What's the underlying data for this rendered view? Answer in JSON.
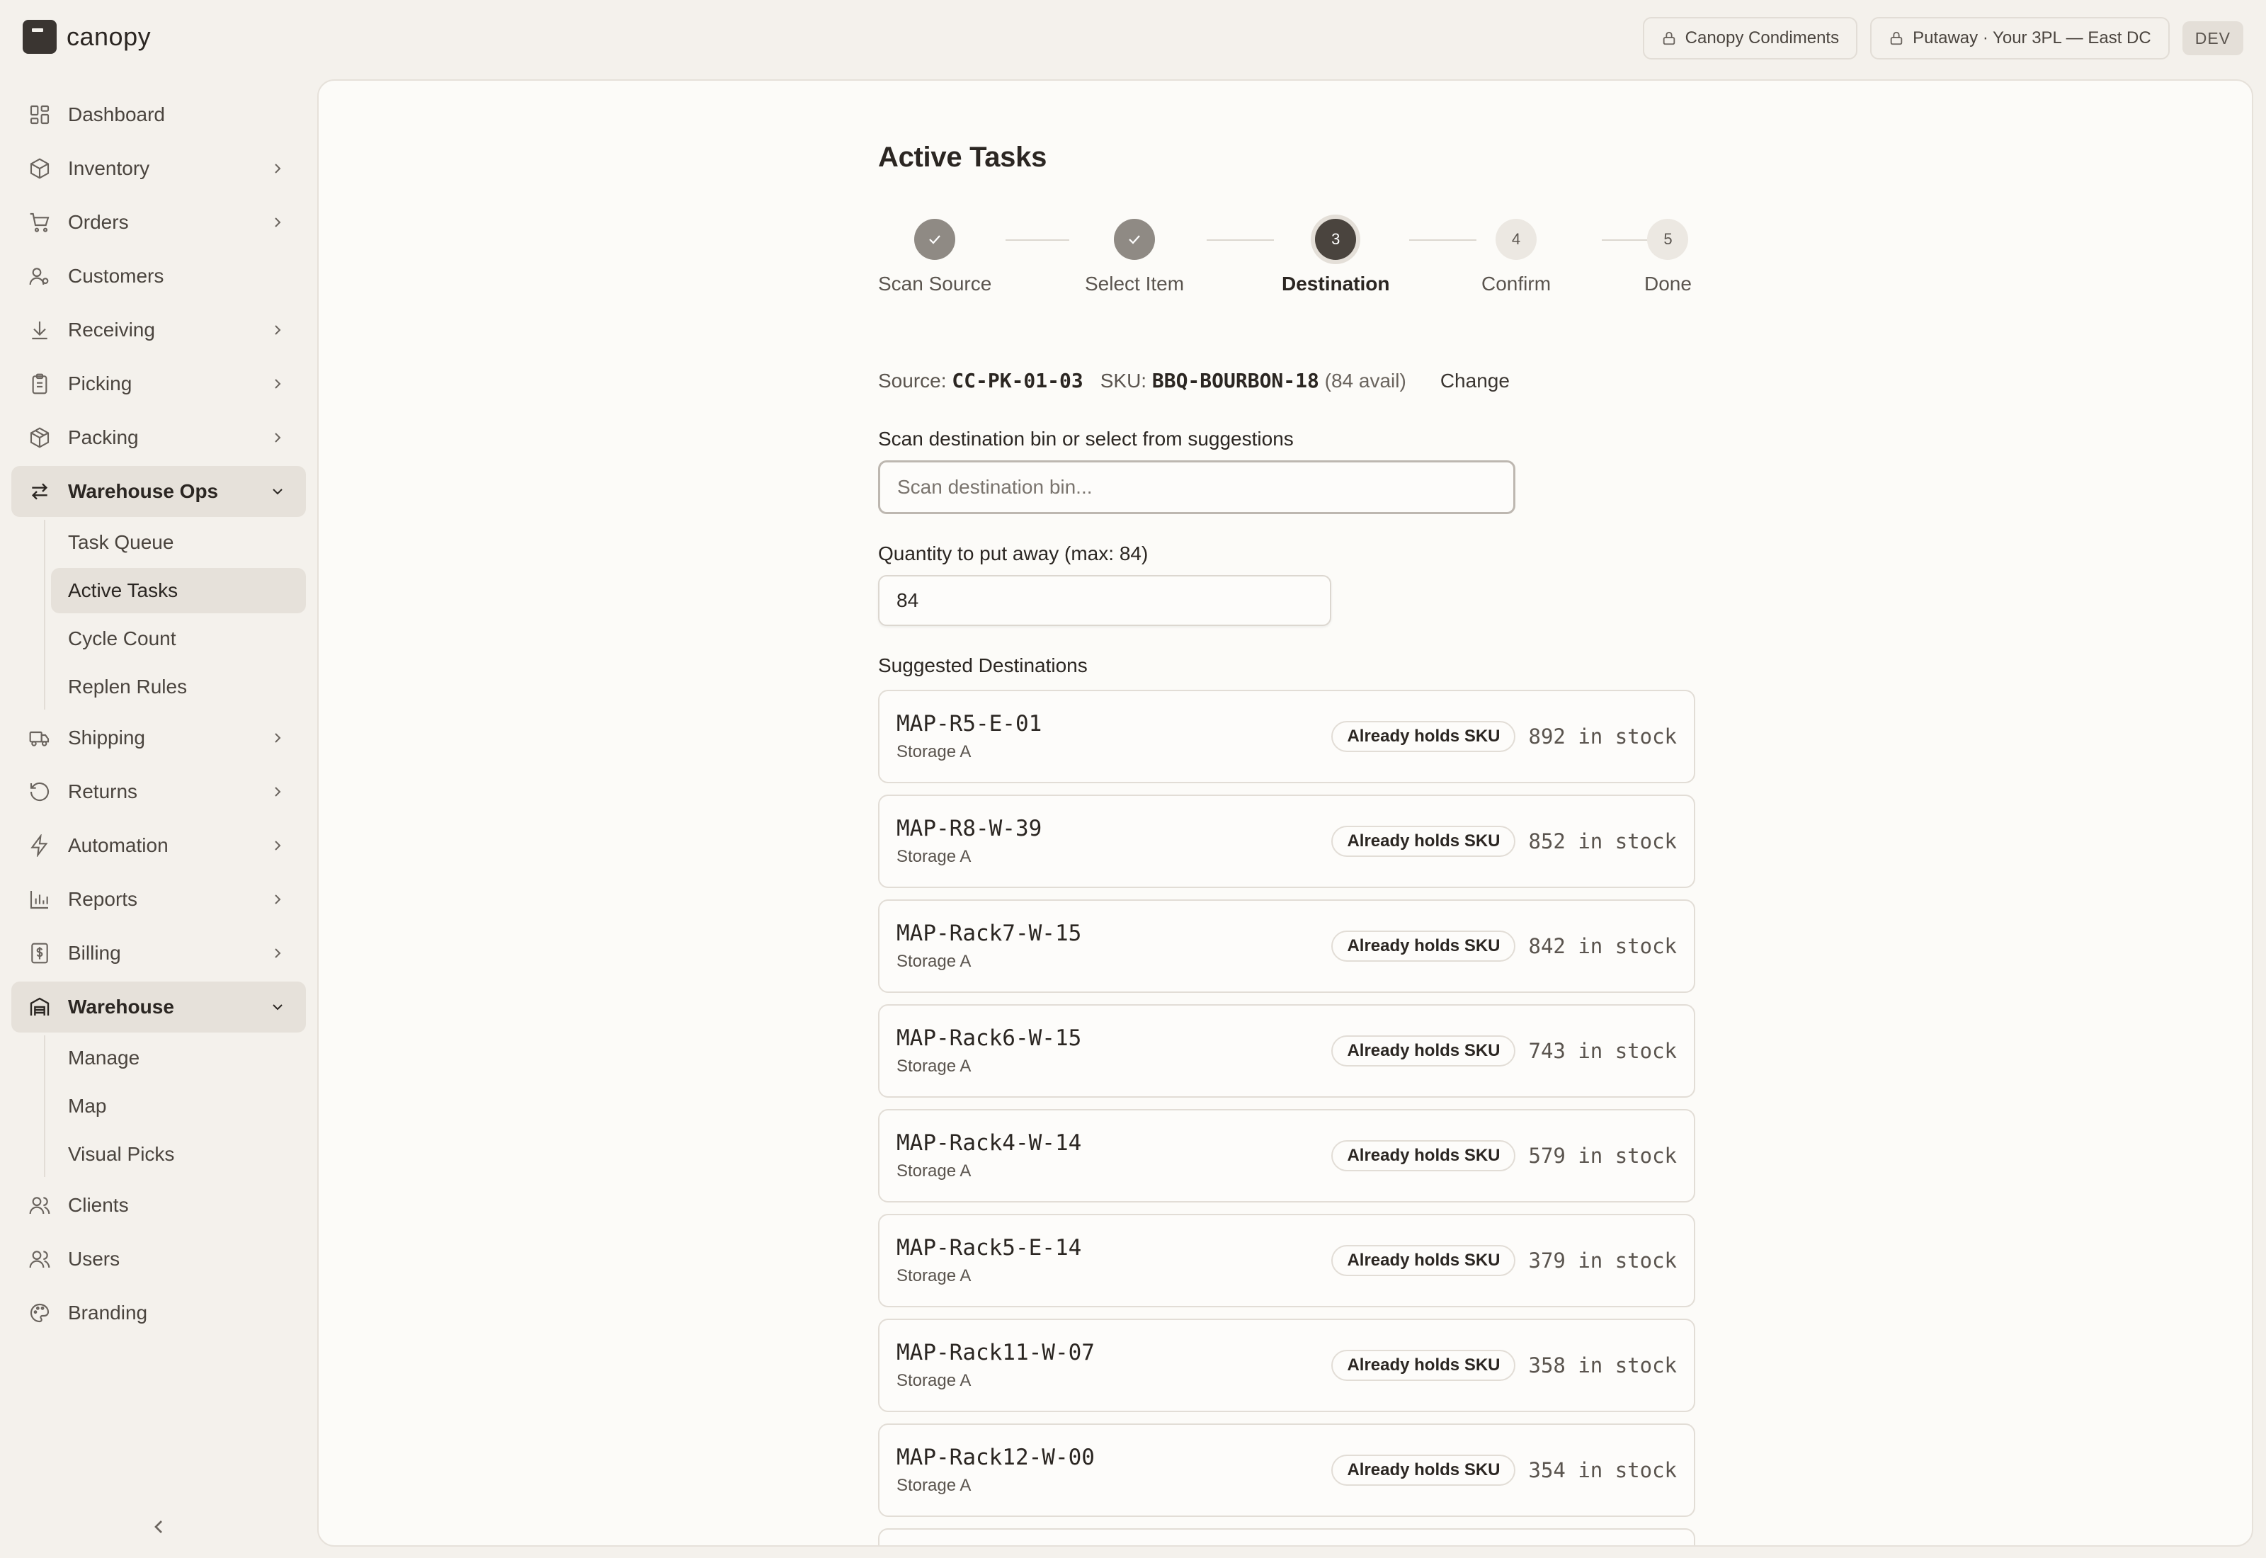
{
  "app": {
    "name": "canopy"
  },
  "header": {
    "client": "Canopy Condiments",
    "context": "Putaway · Your 3PL — East DC",
    "env": "DEV"
  },
  "sidebar": {
    "items": [
      {
        "label": "Dashboard",
        "icon": "dashboard-icon"
      },
      {
        "label": "Inventory",
        "icon": "box-icon"
      },
      {
        "label": "Orders",
        "icon": "cart-icon"
      },
      {
        "label": "Customers",
        "icon": "customer-icon"
      },
      {
        "label": "Receiving",
        "icon": "download-icon"
      },
      {
        "label": "Picking",
        "icon": "clipboard-icon"
      },
      {
        "label": "Packing",
        "icon": "package-icon"
      },
      {
        "label": "Warehouse Ops",
        "icon": "transfer-icon"
      },
      {
        "label": "Shipping",
        "icon": "truck-icon"
      },
      {
        "label": "Returns",
        "icon": "returns-icon"
      },
      {
        "label": "Automation",
        "icon": "lightning-icon"
      },
      {
        "label": "Reports",
        "icon": "bar-chart-icon"
      },
      {
        "label": "Billing",
        "icon": "billing-icon"
      },
      {
        "label": "Warehouse",
        "icon": "warehouse-icon"
      },
      {
        "label": "Clients",
        "icon": "clients-icon"
      },
      {
        "label": "Users",
        "icon": "users-icon"
      },
      {
        "label": "Branding",
        "icon": "palette-icon"
      }
    ],
    "warehouse_ops_sub": [
      "Task Queue",
      "Active Tasks",
      "Cycle Count",
      "Replen Rules"
    ],
    "warehouse_sub": [
      "Manage",
      "Map",
      "Visual Picks"
    ]
  },
  "page": {
    "title": "Active Tasks",
    "steps": [
      {
        "num": "1",
        "label": "Scan Source",
        "state": "done"
      },
      {
        "num": "2",
        "label": "Select Item",
        "state": "done"
      },
      {
        "num": "3",
        "label": "Destination",
        "state": "current"
      },
      {
        "num": "4",
        "label": "Confirm",
        "state": "pending"
      },
      {
        "num": "5",
        "label": "Done",
        "state": "pending"
      }
    ],
    "source": {
      "source_label": "Source:",
      "source_value": "CC-PK-01-03",
      "sku_label": "SKU:",
      "sku_value": "BBQ-BOURBON-18",
      "avail": "(84 avail)",
      "change": "Change"
    },
    "scan_label": "Scan destination bin or select from suggestions",
    "scan_placeholder": "Scan destination bin...",
    "qty_label": "Quantity to put away (max: 84)",
    "qty_value": "84",
    "suggested_label": "Suggested Destinations",
    "destinations": [
      {
        "code": "MAP-R5-E-01",
        "zone": "Storage A",
        "badge": "Already holds SKU",
        "stock": "892 in stock"
      },
      {
        "code": "MAP-R8-W-39",
        "zone": "Storage A",
        "badge": "Already holds SKU",
        "stock": "852 in stock"
      },
      {
        "code": "MAP-Rack7-W-15",
        "zone": "Storage A",
        "badge": "Already holds SKU",
        "stock": "842 in stock"
      },
      {
        "code": "MAP-Rack6-W-15",
        "zone": "Storage A",
        "badge": "Already holds SKU",
        "stock": "743 in stock"
      },
      {
        "code": "MAP-Rack4-W-14",
        "zone": "Storage A",
        "badge": "Already holds SKU",
        "stock": "579 in stock"
      },
      {
        "code": "MAP-Rack5-E-14",
        "zone": "Storage A",
        "badge": "Already holds SKU",
        "stock": "379 in stock"
      },
      {
        "code": "MAP-Rack11-W-07",
        "zone": "Storage A",
        "badge": "Already holds SKU",
        "stock": "358 in stock"
      },
      {
        "code": "MAP-Rack12-W-00",
        "zone": "Storage A",
        "badge": "Already holds SKU",
        "stock": "354 in stock"
      }
    ]
  }
}
